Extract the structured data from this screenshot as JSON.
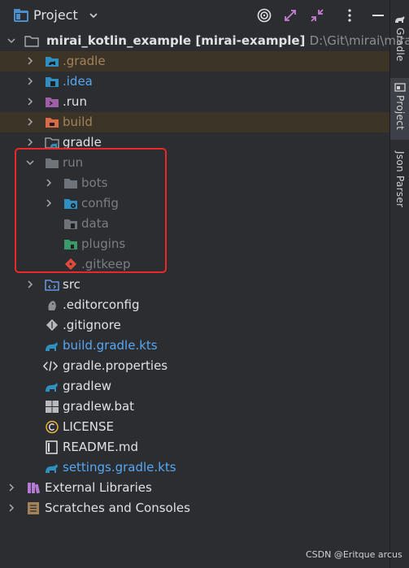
{
  "header": {
    "title": "Project"
  },
  "root": {
    "name": "mirai_kotlin_example",
    "module": "[mirai-example]",
    "path": "D:\\Git\\mirai\\mirai_k"
  },
  "tree": [
    {
      "label": ".gradle",
      "style": "brown",
      "icon": "gradle-folder-icon"
    },
    {
      "label": ".idea",
      "style": "blue",
      "icon": "idea-folder-icon"
    },
    {
      "label": ".run",
      "style": "normal",
      "icon": "run-folder-icon"
    },
    {
      "label": "build",
      "style": "brown",
      "icon": "build-folder-icon"
    },
    {
      "label": "gradle",
      "style": "normal",
      "icon": "gradle-folder-icon"
    },
    {
      "label": "run",
      "style": "gray",
      "icon": "folder-icon"
    },
    {
      "label": "bots",
      "style": "gray",
      "icon": "folder-icon"
    },
    {
      "label": "config",
      "style": "gray",
      "icon": "config-folder-icon"
    },
    {
      "label": "data",
      "style": "gray",
      "icon": "data-folder-icon"
    },
    {
      "label": "plugins",
      "style": "gray",
      "icon": "plugins-folder-icon"
    },
    {
      "label": ".gitkeep",
      "style": "gray",
      "icon": "git-icon"
    },
    {
      "label": "src",
      "style": "normal",
      "icon": "src-folder-icon"
    },
    {
      "label": ".editorconfig",
      "style": "normal",
      "icon": "editorconfig-icon"
    },
    {
      "label": ".gitignore",
      "style": "normal",
      "icon": "gitignore-icon"
    },
    {
      "label": "build.gradle.kts",
      "style": "blue",
      "icon": "gradle-icon"
    },
    {
      "label": "gradle.properties",
      "style": "normal",
      "icon": "properties-icon"
    },
    {
      "label": "gradlew",
      "style": "normal",
      "icon": "gradle-icon"
    },
    {
      "label": "gradlew.bat",
      "style": "normal",
      "icon": "windows-icon"
    },
    {
      "label": "LICENSE",
      "style": "normal",
      "icon": "license-icon"
    },
    {
      "label": "README.md",
      "style": "normal",
      "icon": "markdown-icon"
    },
    {
      "label": "settings.gradle.kts",
      "style": "blue",
      "icon": "gradle-icon"
    },
    {
      "label": "External Libraries",
      "style": "normal",
      "icon": "libraries-icon"
    },
    {
      "label": "Scratches and Consoles",
      "style": "normal",
      "icon": "scratches-icon"
    }
  ],
  "right_strip": {
    "gradle": "Gradle",
    "project": "Project",
    "json_parser": "Json Parser"
  },
  "watermark": "CSDN @Eritque arcus",
  "colors": {
    "background": "#2b2d30",
    "excluded_bg": "#3d3428",
    "highlight_box": "#e8282b",
    "blue_text": "#56a8f5",
    "gray_text": "#7a7e85"
  }
}
